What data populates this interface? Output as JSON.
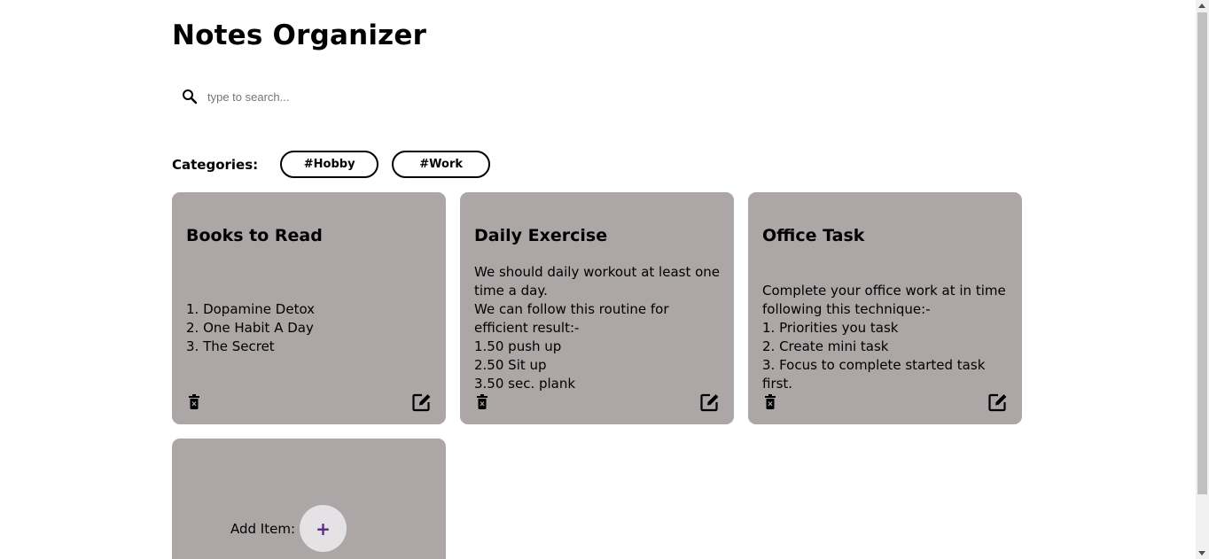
{
  "app": {
    "title": "Notes Organizer"
  },
  "search": {
    "placeholder": "type to search..."
  },
  "categories": {
    "label": "Categories:",
    "chips": [
      "#Hobby",
      "#Work"
    ]
  },
  "notes": [
    {
      "title": "Books to Read",
      "body": "1. Dopamine Detox\n2. One Habit A Day\n3. The Secret"
    },
    {
      "title": "Daily Exercise",
      "body": "We should daily workout at least one time a day.\nWe can follow this routine for efficient result:-\n1.50 push up\n2.50 Sit up\n3.50 sec. plank"
    },
    {
      "title": "Office Task",
      "body": "Complete your office work at in time following this technique:-\n1. Priorities you task\n2. Create mini task\n3. Focus to complete started task first."
    }
  ],
  "add_item": {
    "label": "Add Item:",
    "button": "+"
  },
  "colors": {
    "card_bg": "#aca6a6",
    "add_button_bg": "#e4e2e4",
    "add_button_fg": "#5b2a86"
  },
  "icons": {
    "search": "search-icon",
    "delete": "trash-icon",
    "edit": "edit-icon"
  }
}
